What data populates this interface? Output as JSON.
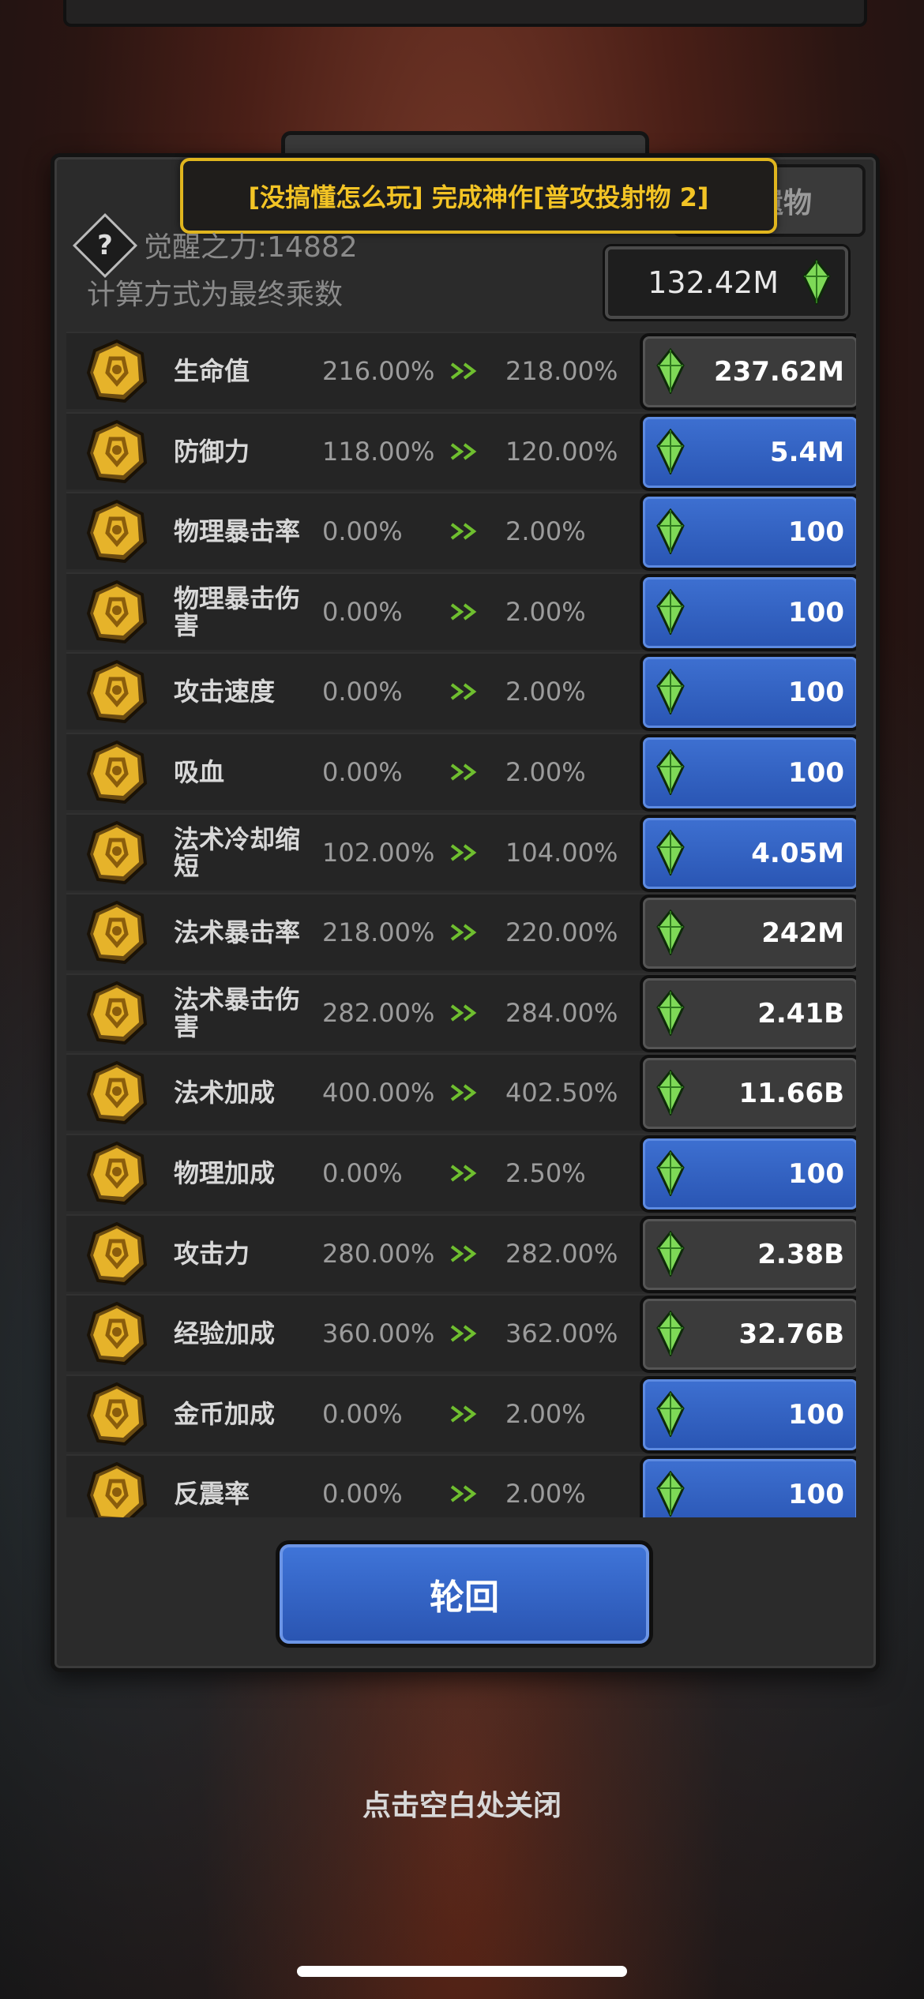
{
  "quest_banner": "[没搞懂怎么玩] 完成神作[普攻投射物 2]",
  "tab_relic": "圣遗物",
  "awaken_power": "觉醒之力:14882",
  "calc_note": "计算方式为最终乘数",
  "currency": "132.42M",
  "stats": [
    {
      "name": "生命值",
      "current": "216.00%",
      "next": "218.00%",
      "cost": "237.62M",
      "style": "gray"
    },
    {
      "name": "防御力",
      "current": "118.00%",
      "next": "120.00%",
      "cost": "5.4M",
      "style": "blue"
    },
    {
      "name": "物理暴击率",
      "current": "0.00%",
      "next": "2.00%",
      "cost": "100",
      "style": "blue"
    },
    {
      "name": "物理暴击伤害",
      "current": "0.00%",
      "next": "2.00%",
      "cost": "100",
      "style": "blue"
    },
    {
      "name": "攻击速度",
      "current": "0.00%",
      "next": "2.00%",
      "cost": "100",
      "style": "blue"
    },
    {
      "name": "吸血",
      "current": "0.00%",
      "next": "2.00%",
      "cost": "100",
      "style": "blue"
    },
    {
      "name": "法术冷却缩短",
      "current": "102.00%",
      "next": "104.00%",
      "cost": "4.05M",
      "style": "blue"
    },
    {
      "name": "法术暴击率",
      "current": "218.00%",
      "next": "220.00%",
      "cost": "242M",
      "style": "gray"
    },
    {
      "name": "法术暴击伤害",
      "current": "282.00%",
      "next": "284.00%",
      "cost": "2.41B",
      "style": "gray"
    },
    {
      "name": "法术加成",
      "current": "400.00%",
      "next": "402.50%",
      "cost": "11.66B",
      "style": "gray"
    },
    {
      "name": "物理加成",
      "current": "0.00%",
      "next": "2.50%",
      "cost": "100",
      "style": "blue"
    },
    {
      "name": "攻击力",
      "current": "280.00%",
      "next": "282.00%",
      "cost": "2.38B",
      "style": "gray"
    },
    {
      "name": "经验加成",
      "current": "360.00%",
      "next": "362.00%",
      "cost": "32.76B",
      "style": "gray"
    },
    {
      "name": "金币加成",
      "current": "0.00%",
      "next": "2.00%",
      "cost": "100",
      "style": "blue"
    },
    {
      "name": "反震率",
      "current": "0.00%",
      "next": "2.00%",
      "cost": "100",
      "style": "blue"
    }
  ],
  "rebirth_label": "轮回",
  "close_hint": "点击空白处关闭",
  "colors": {
    "gold": "#f3c425",
    "blue_button": "#2f5fc0",
    "gray_button": "#3b3b3b",
    "gem_green": "#7ed957"
  },
  "icons": {
    "row_icon": "gold-rune-medal-icon",
    "currency_icon": "green-gem-icon",
    "arrow_icon": "double-chevron-right-icon",
    "info_icon": "question-mark-icon"
  }
}
